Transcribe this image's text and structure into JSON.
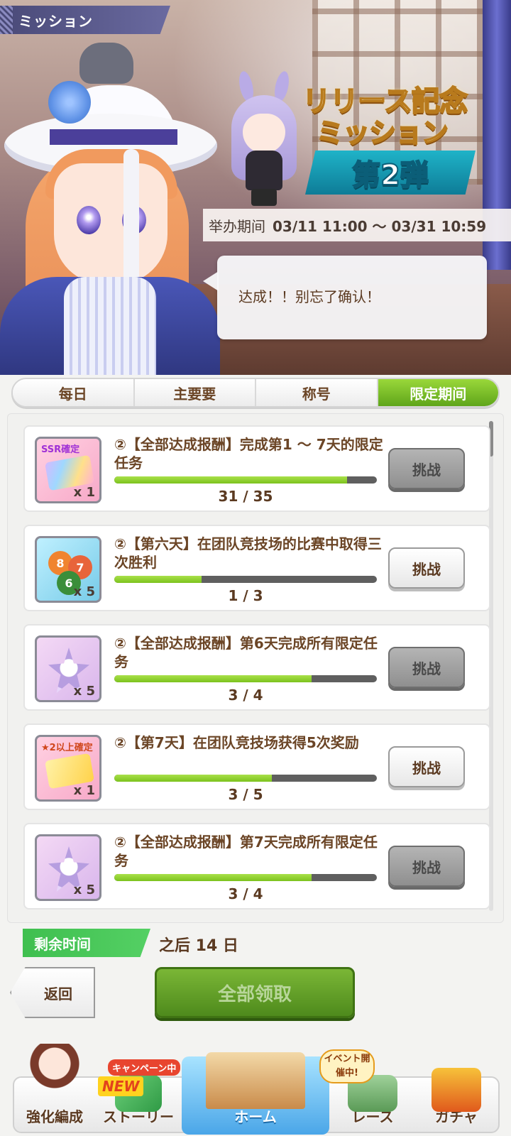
{
  "header": {
    "title": "ミッション"
  },
  "banner": {
    "event_logo_line1": "リリース記念",
    "event_logo_line2": "ミッション",
    "event_logo_sub": "第2弾",
    "period_label": "举办期间",
    "period_value": "03/11 11:00 ～ 03/31 10:59",
    "speech": "达成！！别忘了确认！"
  },
  "tabs": [
    {
      "label": "每日",
      "active": false
    },
    {
      "label": "主要要",
      "active": false
    },
    {
      "label": "称号",
      "active": false
    },
    {
      "label": "限定期间",
      "active": true
    }
  ],
  "missions": [
    {
      "title": "②【全部达成报酬】完成第1 ～ 7天的限定任务",
      "progress_current": 31,
      "progress_total": 35,
      "count": "31 / 35",
      "reward_label": "SSR確定",
      "reward_qty": "x 1",
      "reward_icon": "ssr-ticket-icon",
      "button": "挑战",
      "button_state": "disabled"
    },
    {
      "title": "②【第六天】在团队竞技场的比赛中取得三次胜利",
      "progress_current": 1,
      "progress_total": 3,
      "count": "1 / 3",
      "reward_label": "",
      "reward_qty": "x 5",
      "reward_icon": "balls-icon",
      "ball_numbers": [
        "8",
        "7",
        "6"
      ],
      "button": "挑战",
      "button_state": "enabled"
    },
    {
      "title": "②【全部达成报酬】第6天完成所有限定任务",
      "progress_current": 3,
      "progress_total": 4,
      "count": "3 / 4",
      "reward_label": "",
      "reward_qty": "x 5",
      "reward_icon": "character-piece-icon",
      "button": "挑战",
      "button_state": "disabled"
    },
    {
      "title": "②【第7天】在团队竞技场获得5次奖励",
      "progress_current": 3,
      "progress_total": 5,
      "count": "3 / 5",
      "reward_label": "★2以上確定",
      "reward_qty": "x 1",
      "reward_icon": "gold-ticket-icon",
      "button": "挑战",
      "button_state": "enabled"
    },
    {
      "title": "②【全部达成报酬】第7天完成所有限定任务",
      "progress_current": 3,
      "progress_total": 4,
      "count": "3 / 4",
      "reward_label": "",
      "reward_qty": "x 5",
      "reward_icon": "character-piece-icon",
      "button": "挑战",
      "button_state": "disabled"
    }
  ],
  "remaining": {
    "label": "剩余时间",
    "value": "之后 14 日"
  },
  "actions": {
    "back_label": "返回",
    "claim_all_label": "全部领取"
  },
  "bottom_nav": [
    {
      "label": "強化編成",
      "icon": "character-icon"
    },
    {
      "label": "ストーリー",
      "icon": "book-icon",
      "badge_top": "キャンペーン中",
      "badge_new": "NEW"
    },
    {
      "label": "ホーム",
      "icon": "school-icon",
      "active": true
    },
    {
      "label": "レース",
      "icon": "gate-icon",
      "badge_event": "イベント開催中!"
    },
    {
      "label": "ガチャ",
      "icon": "gacha-door-icon"
    }
  ],
  "colors": {
    "accent_green": "#5fa51a",
    "text_brown": "#5b3a21",
    "remain_green": "#3fbf4f"
  }
}
